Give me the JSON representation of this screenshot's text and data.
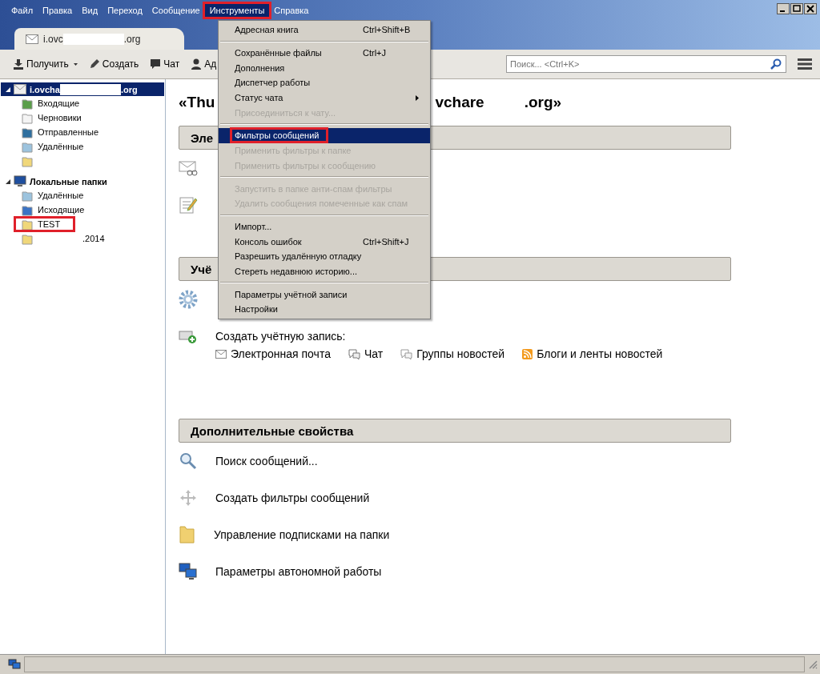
{
  "menubar": [
    {
      "label": "Файл",
      "selected": false,
      "annotated": false
    },
    {
      "label": "Правка",
      "selected": false,
      "annotated": false
    },
    {
      "label": "Вид",
      "selected": false,
      "annotated": false
    },
    {
      "label": "Переход",
      "selected": false,
      "annotated": false
    },
    {
      "label": "Сообщение",
      "selected": false,
      "annotated": false
    },
    {
      "label": "Инструменты",
      "selected": true,
      "annotated": true
    },
    {
      "label": "Справка",
      "selected": false,
      "annotated": false
    }
  ],
  "tab": {
    "parts": [
      "i.ovc",
      ".org"
    ]
  },
  "toolbar": [
    {
      "label": "Получить",
      "kind": "get"
    },
    {
      "kind": "caret"
    },
    {
      "label": "Создать",
      "kind": "write"
    },
    {
      "label": "Чат",
      "kind": "chat"
    },
    {
      "label": "Ад",
      "kind": "person"
    }
  ],
  "search": {
    "placeholder": "Поиск... <Ctrl+K>"
  },
  "sidebar": [
    {
      "parts": [
        "i.ovcha",
        ".org"
      ],
      "kind": "account",
      "selected": true,
      "expanded": true,
      "children": [
        {
          "parts": [
            "Входящие"
          ],
          "kind": "inbox",
          "annotated": false
        },
        {
          "parts": [
            "Черновики"
          ],
          "kind": "drafts",
          "annotated": false
        },
        {
          "parts": [
            "Отправленные"
          ],
          "kind": "sent",
          "annotated": false
        },
        {
          "parts": [
            "Удалённые"
          ],
          "kind": "trash",
          "annotated": false
        },
        {
          "kind": "folder",
          "annotated": false
        }
      ]
    },
    {
      "parts": [
        "Локальные папки"
      ],
      "kind": "local",
      "selected": false,
      "expanded": true,
      "children": [
        {
          "parts": [
            "Удалённые"
          ],
          "kind": "trash",
          "annotated": false
        },
        {
          "parts": [
            "Исходящие"
          ],
          "kind": "outbox",
          "annotated": false
        },
        {
          "parts": [
            "TEST"
          ],
          "kind": "folder",
          "annotated": true
        },
        {
          "parts": [
            ".2014"
          ],
          "kind": "folder-gap",
          "annotated": false
        }
      ]
    }
  ],
  "main": {
    "title_parts": [
      "«Thu",
      "vchare",
      ".org»"
    ],
    "sections": [
      {
        "title": "Эле",
        "rows": [
          {
            "kind": "read"
          },
          {
            "kind": "write"
          }
        ]
      },
      {
        "title": "Учё",
        "rows": [
          {
            "kind": "gear"
          },
          {
            "kind": "create",
            "text": "Создать учётную запись:"
          },
          {
            "kind": "links",
            "links": [
              {
                "kind": "mail",
                "label": "Электронная почта"
              },
              {
                "kind": "chat",
                "label": "Чат"
              },
              {
                "kind": "news",
                "label": "Группы новостей"
              },
              {
                "kind": "rss",
                "label": "Блоги и ленты новостей"
              }
            ]
          }
        ]
      },
      {
        "title": "Дополнительные свойства",
        "rows": [
          {
            "kind": "search",
            "text": "Поиск сообщений..."
          },
          {
            "kind": "filter",
            "text": "Создать фильтры сообщений"
          },
          {
            "kind": "folder",
            "text": "Управление подписками на папки"
          },
          {
            "kind": "offline",
            "text": "Параметры автономной работы"
          }
        ]
      }
    ]
  },
  "menu": [
    {
      "kind": "item",
      "label": "Адресная книга",
      "shortcut": "Ctrl+Shift+B",
      "disabled": false,
      "selected": false,
      "submenu": false,
      "annotated": false
    },
    {
      "kind": "separator"
    },
    {
      "kind": "item",
      "label": "Сохранённые файлы",
      "shortcut": "Ctrl+J",
      "disabled": false,
      "selected": false,
      "submenu": false,
      "annotated": false
    },
    {
      "kind": "item",
      "label": "Дополнения",
      "disabled": false,
      "selected": false,
      "submenu": false,
      "annotated": false
    },
    {
      "kind": "item",
      "label": "Диспетчер работы",
      "disabled": false,
      "selected": false,
      "submenu": false,
      "annotated": false
    },
    {
      "kind": "item",
      "label": "Статус чата",
      "disabled": false,
      "selected": false,
      "submenu": true,
      "annotated": false
    },
    {
      "kind": "item",
      "label": "Присоединиться к чату...",
      "disabled": true,
      "selected": false,
      "submenu": false,
      "annotated": false
    },
    {
      "kind": "separator"
    },
    {
      "kind": "item",
      "label": "Фильтры сообщений",
      "disabled": false,
      "selected": true,
      "submenu": false,
      "annotated": true
    },
    {
      "kind": "item",
      "label": "Применить фильтры к папке",
      "disabled": true,
      "selected": false,
      "submenu": false,
      "annotated": false
    },
    {
      "kind": "item",
      "label": "Применить фильтры к сообщению",
      "disabled": true,
      "selected": false,
      "submenu": false,
      "annotated": false
    },
    {
      "kind": "separator"
    },
    {
      "kind": "item",
      "label": "Запустить в папке анти-спам фильтры",
      "disabled": true,
      "selected": false,
      "submenu": false,
      "annotated": false
    },
    {
      "kind": "item",
      "label": "Удалить сообщения помеченные как спам",
      "disabled": true,
      "selected": false,
      "submenu": false,
      "annotated": false
    },
    {
      "kind": "separator"
    },
    {
      "kind": "item",
      "label": "Импорт...",
      "disabled": false,
      "selected": false,
      "submenu": false,
      "annotated": false
    },
    {
      "kind": "item",
      "label": "Консоль ошибок",
      "shortcut": "Ctrl+Shift+J",
      "disabled": false,
      "selected": false,
      "submenu": false,
      "annotated": false
    },
    {
      "kind": "item",
      "label": "Разрешить удалённую отладку",
      "disabled": false,
      "selected": false,
      "submenu": false,
      "annotated": false
    },
    {
      "kind": "item",
      "label": "Стереть недавнюю историю...",
      "disabled": false,
      "selected": false,
      "submenu": false,
      "annotated": false
    },
    {
      "kind": "separator"
    },
    {
      "kind": "item",
      "label": "Параметры учётной записи",
      "disabled": false,
      "selected": false,
      "submenu": false,
      "annotated": false
    },
    {
      "kind": "item",
      "label": "Настройки",
      "disabled": false,
      "selected": false,
      "submenu": false,
      "annotated": false
    }
  ]
}
